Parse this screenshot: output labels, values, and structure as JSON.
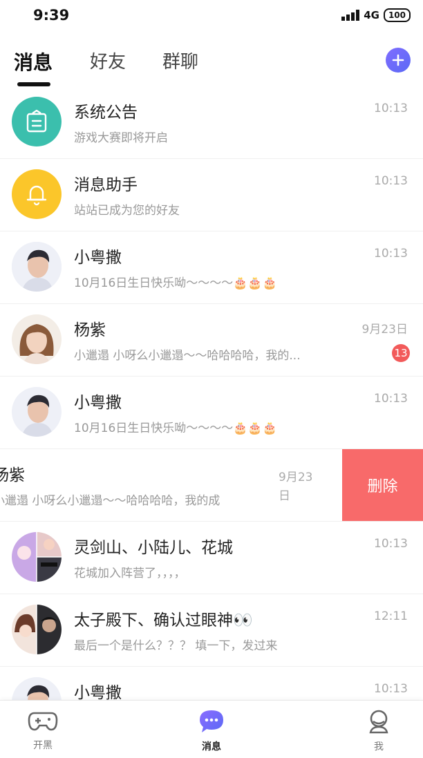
{
  "status": {
    "time": "9:39",
    "network": "4G",
    "battery": "100"
  },
  "tabs": [
    {
      "label": "消息",
      "active": true
    },
    {
      "label": "好友",
      "active": false
    },
    {
      "label": "群聊",
      "active": false
    }
  ],
  "conversations": [
    {
      "title": "系统公告",
      "preview": "游戏大赛即将开启",
      "time": "10:13",
      "avatar": "notice-icon"
    },
    {
      "title": "消息助手",
      "preview": "站站已成为您的好友",
      "time": "10:13",
      "avatar": "bell-icon"
    },
    {
      "title": "小粤撒",
      "preview": "10月16日生日快乐呦～～～～🎂🎂🎂",
      "time": "10:13",
      "avatar": "user-photo"
    },
    {
      "title": "杨紫",
      "preview": "小邋遢  小呀么小邋遢～～哈哈哈哈，我的...",
      "time": "9月23日",
      "badge": "13",
      "avatar": "user-photo"
    },
    {
      "title": "小粤撒",
      "preview": "10月16日生日快乐呦～～～～🎂🎂🎂",
      "time": "10:13",
      "avatar": "user-photo"
    },
    {
      "title": "灵剑山、小陆儿、花城",
      "preview": "花城加入阵营了，，，，",
      "time": "10:13",
      "avatar": "group-avatar"
    },
    {
      "title": "太子殿下、确认过眼神👀",
      "preview": "最后一个是什么？？？ 填一下，发过来",
      "time": "12:11",
      "avatar": "group-avatar"
    },
    {
      "title": "小粤撒",
      "preview": "",
      "time": "10:13",
      "avatar": "user-photo"
    }
  ],
  "swiped_row": {
    "title": "杨紫",
    "preview": "小邋遢  小呀么小邋遢～～哈哈哈哈，我的成",
    "time": "9月23日",
    "delete_label": "删除"
  },
  "bottom_nav": [
    {
      "label": "开黑",
      "icon": "gamepad-icon",
      "active": false
    },
    {
      "label": "消息",
      "icon": "chat-bubble-icon",
      "active": true
    },
    {
      "label": "我",
      "icon": "profile-icon",
      "active": false
    }
  ],
  "colors": {
    "accent": "#6a6cf7",
    "delete": "#f86a6a",
    "badge": "#f25a5a",
    "notice": "#3bbfad",
    "bell": "#fbc62a"
  }
}
